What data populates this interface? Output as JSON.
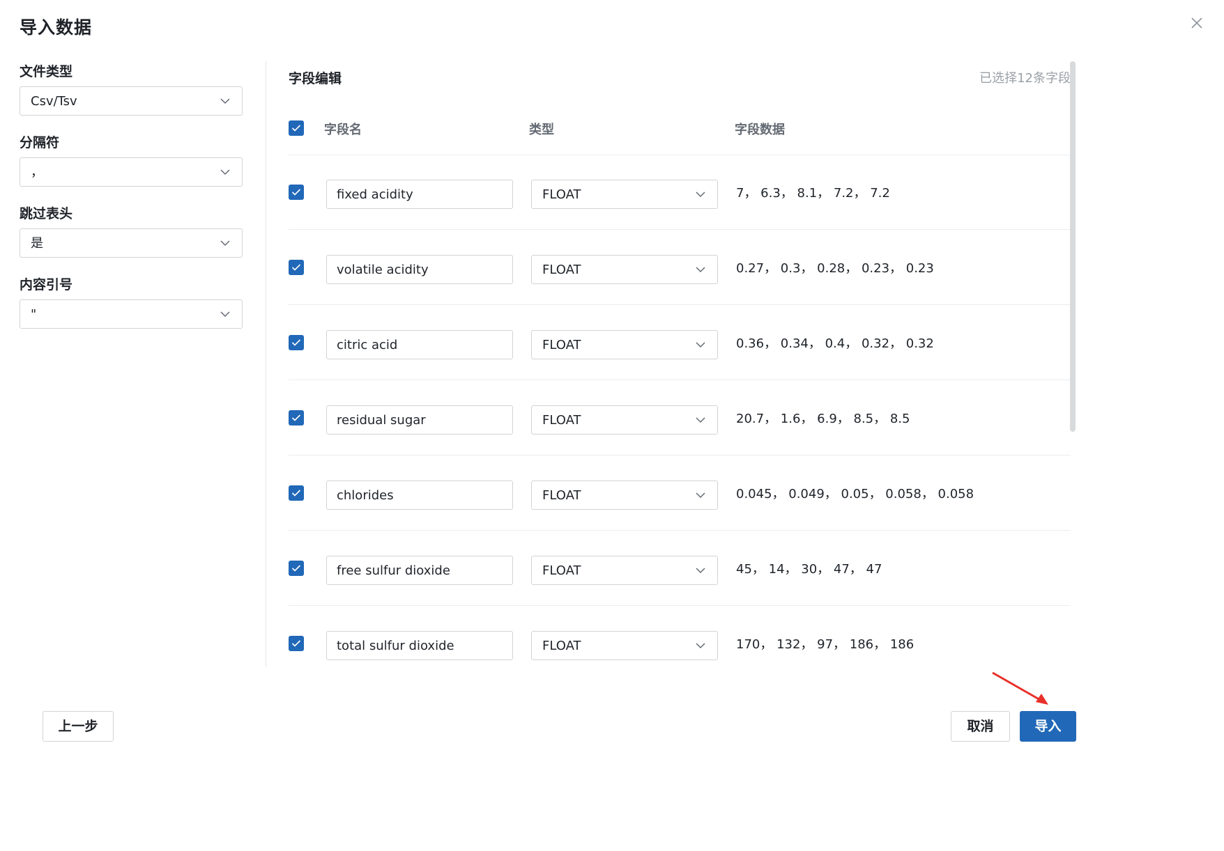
{
  "dialog": {
    "title": "导入数据"
  },
  "settings": {
    "file_type_label": "文件类型",
    "file_type_value": "Csv/Tsv",
    "separator_label": "分隔符",
    "separator_value": "，",
    "skip_header_label": "跳过表头",
    "skip_header_value": "是",
    "quote_label": "内容引号",
    "quote_value": "\""
  },
  "field_editor": {
    "title": "字段编辑",
    "selected_count": "已选择12条字段",
    "columns": {
      "name": "字段名",
      "type": "类型",
      "data": "字段数据"
    },
    "rows": [
      {
        "name": "fixed acidity",
        "type": "FLOAT",
        "data": "7，  6.3，  8.1，  7.2，  7.2"
      },
      {
        "name": "volatile acidity",
        "type": "FLOAT",
        "data": "0.27，  0.3，  0.28，  0.23，  0.23"
      },
      {
        "name": "citric acid",
        "type": "FLOAT",
        "data": "0.36，  0.34，  0.4，  0.32，  0.32"
      },
      {
        "name": "residual sugar",
        "type": "FLOAT",
        "data": "20.7，  1.6，  6.9，  8.5，  8.5"
      },
      {
        "name": "chlorides",
        "type": "FLOAT",
        "data": "0.045，  0.049，  0.05，  0.058，  0.058"
      },
      {
        "name": "free sulfur dioxide",
        "type": "FLOAT",
        "data": "45，  14，  30，  47，  47"
      },
      {
        "name": "total sulfur dioxide",
        "type": "FLOAT",
        "data": "170，  132，  97，  186，  186"
      }
    ]
  },
  "footer": {
    "prev_label": "上一步",
    "cancel_label": "取消",
    "import_label": "导入"
  },
  "colors": {
    "accent": "#2168b8",
    "annotation_arrow": "#e8302a",
    "border": "#d0d3d6"
  },
  "icons": {
    "close": "close-icon",
    "chevron": "chevron-down-icon",
    "check": "check-icon"
  }
}
